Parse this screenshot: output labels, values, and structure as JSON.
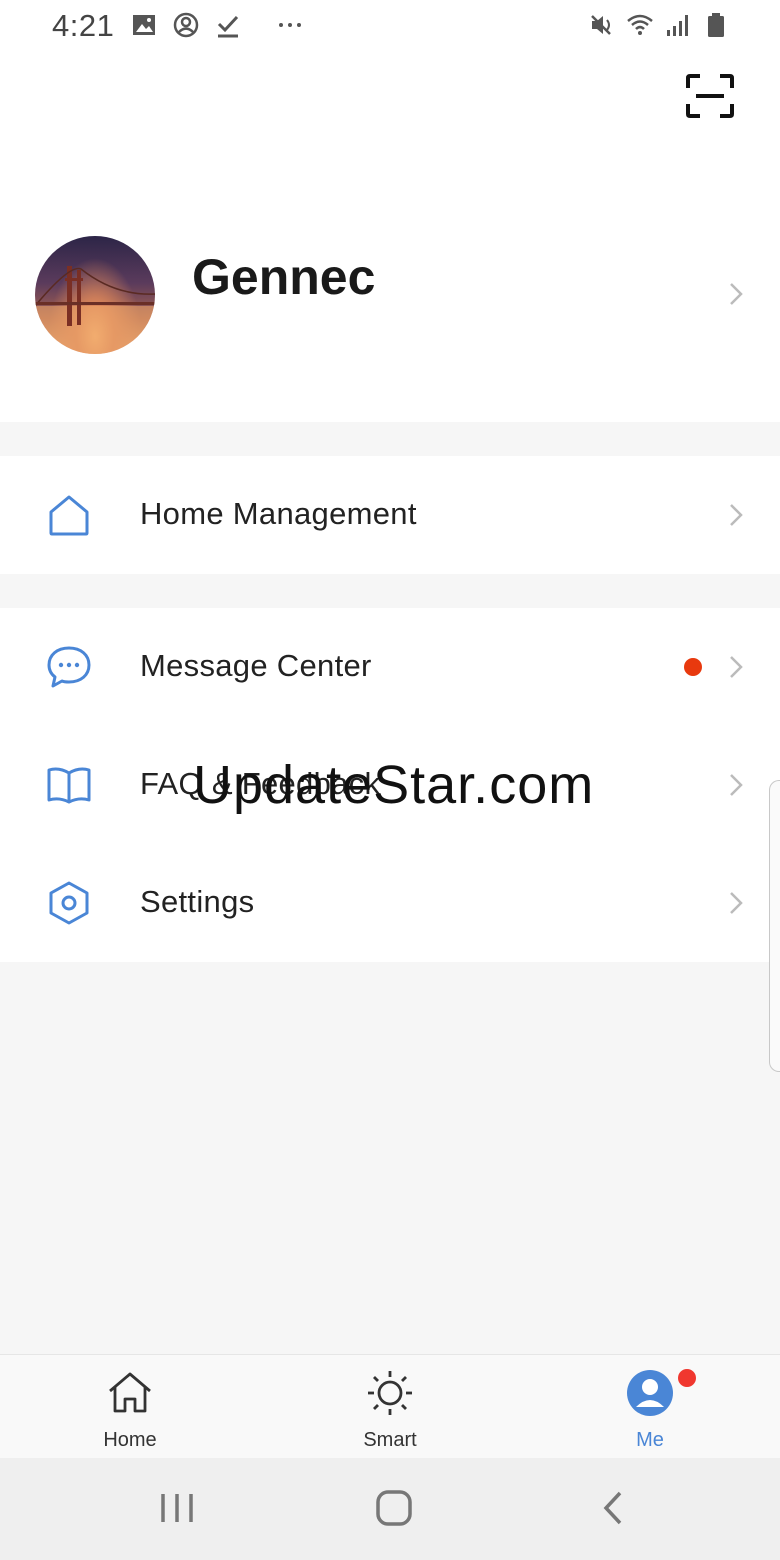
{
  "status_bar": {
    "time": "4:21",
    "left_icons": [
      "image-icon",
      "account-circle-icon",
      "download-done-icon",
      "more-dots-icon"
    ],
    "right_icons": [
      "mute-icon",
      "wifi-icon",
      "signal-icon",
      "battery-icon"
    ]
  },
  "header": {
    "scan_icon": "scan-icon"
  },
  "profile": {
    "name": "Gennec",
    "avatar": "golden-gate-bridge-photo"
  },
  "menu_sections": [
    {
      "items": [
        {
          "icon": "house-icon",
          "label": "Home Management"
        }
      ]
    },
    {
      "items": [
        {
          "icon": "chat-bubble-icon",
          "label": "Message Center",
          "has_notification_dot": true
        },
        {
          "icon": "book-icon",
          "label": "FAQ & Feedback"
        },
        {
          "icon": "hexagon-settings-icon",
          "label": "Settings"
        }
      ]
    }
  ],
  "watermark": "UpdateStar.com",
  "tabbar": {
    "tabs": [
      {
        "label": "Home",
        "icon": "house-icon",
        "active": false
      },
      {
        "label": "Smart",
        "icon": "sun-icon",
        "active": false
      },
      {
        "label": "Me",
        "icon": "person-icon",
        "active": true,
        "badge": true
      }
    ]
  },
  "colors": {
    "accent": "#4a86d6",
    "badge": "#e8390e",
    "background": "#f6f6f6"
  },
  "system_nav": [
    "recents-icon",
    "home-button-icon",
    "back-icon"
  ]
}
